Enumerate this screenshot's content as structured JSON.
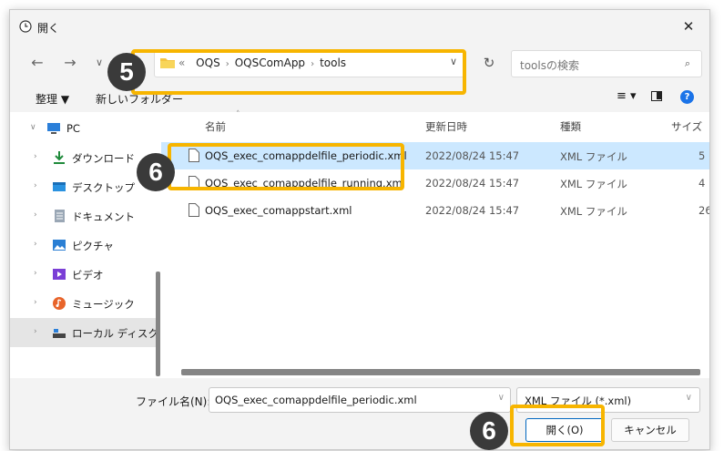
{
  "window": {
    "title": "開く"
  },
  "nav": {
    "back": "←",
    "forward": "→",
    "recent": "∨"
  },
  "address": {
    "prefix": "«",
    "crumbs": [
      "OQS",
      "OQSComApp",
      "tools"
    ]
  },
  "search": {
    "placeholder": "toolsの検索"
  },
  "toolbar": {
    "organize": "整理 ▼",
    "new_folder": "新しいフォルダー"
  },
  "sidebar": {
    "items": [
      {
        "label": "PC"
      },
      {
        "label": "ダウンロード"
      },
      {
        "label": "デスクトップ"
      },
      {
        "label": "ドキュメント"
      },
      {
        "label": "ピクチャ"
      },
      {
        "label": "ビデオ"
      },
      {
        "label": "ミュージック"
      },
      {
        "label": "ローカル ディスク (C"
      }
    ]
  },
  "columns": {
    "name": "名前",
    "date": "更新日時",
    "type": "種類",
    "size": "サイズ"
  },
  "files": [
    {
      "name": "OQS_exec_comappdelfile_periodic.xml",
      "date": "2022/08/24 15:47",
      "type": "XML ファイル",
      "size": "5",
      "selected": true
    },
    {
      "name": "OQS_exec_comappdelfile_running.xml",
      "date": "2022/08/24 15:47",
      "type": "XML ファイル",
      "size": "4",
      "selected": false
    },
    {
      "name": "OQS_exec_comappstart.xml",
      "date": "2022/08/24 15:47",
      "type": "XML ファイル",
      "size": "26",
      "selected": false
    }
  ],
  "bottom": {
    "filename_label": "ファイル名(N):",
    "filename_value": "OQS_exec_comappdelfile_periodic.xml",
    "filetype_value": "XML ファイル (*.xml)",
    "open_label": "開く(O)",
    "cancel_label": "キャンセル"
  },
  "annotations": {
    "step5": "5",
    "step6a": "6",
    "step6b": "6"
  },
  "colors": {
    "highlight": "#f7b500",
    "badge": "#3a3a3a",
    "selection": "#cce8ff",
    "accent": "#0067c0"
  }
}
